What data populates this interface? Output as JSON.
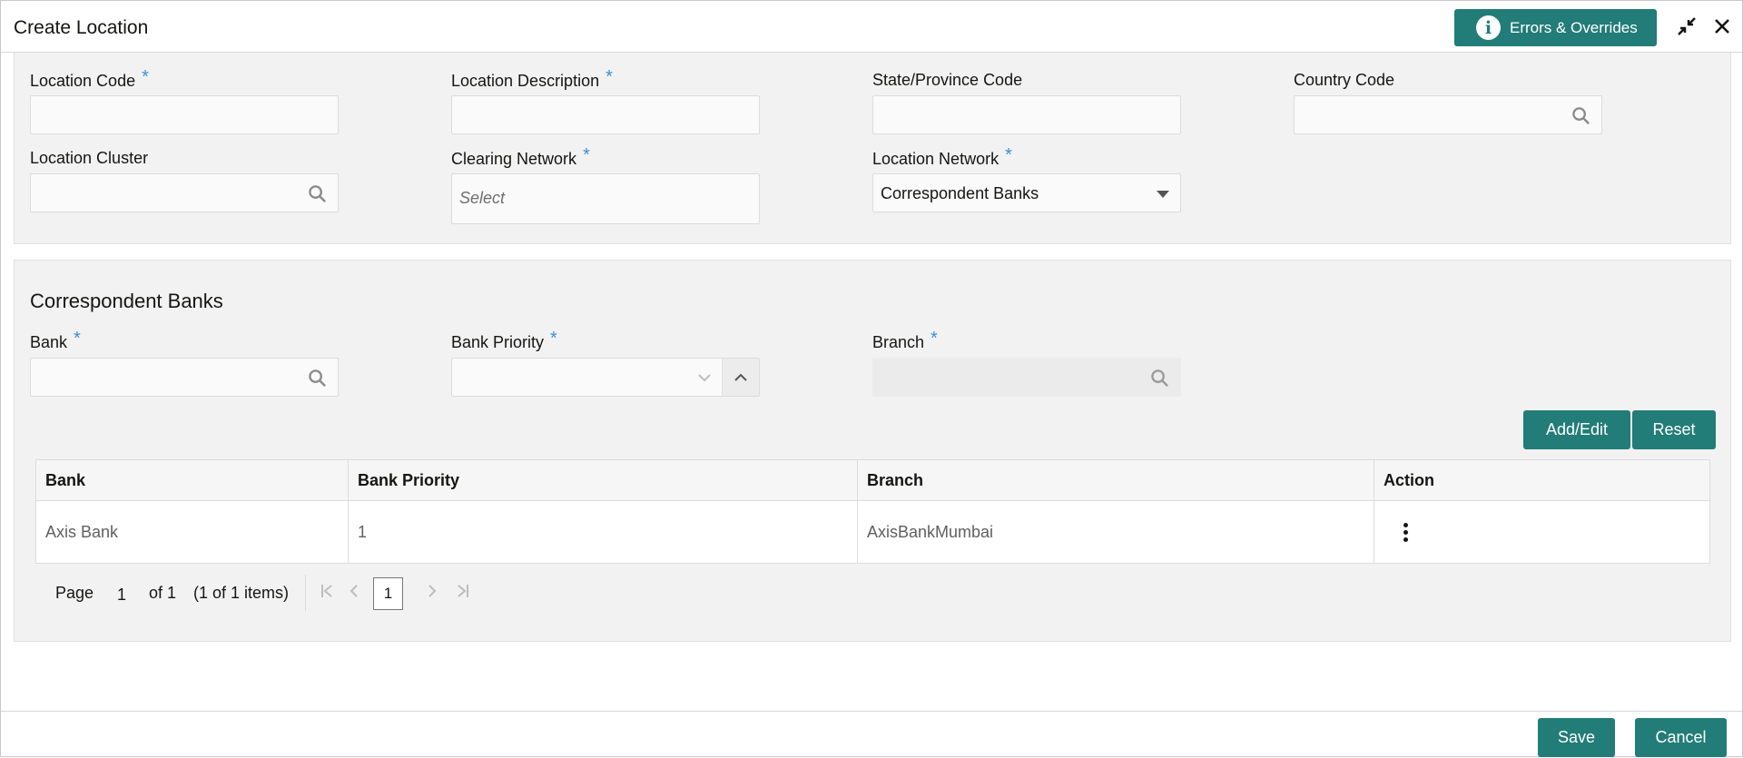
{
  "header": {
    "title": "Create Location",
    "errors_button": "Errors & Overrides",
    "info_icon": "i"
  },
  "form": {
    "location_code": {
      "label": "Location Code",
      "required": "*",
      "value": ""
    },
    "location_description": {
      "label": "Location Description",
      "required": "*",
      "value": ""
    },
    "state_province_code": {
      "label": "State/Province Code",
      "value": ""
    },
    "country_code": {
      "label": "Country Code",
      "value": ""
    },
    "location_cluster": {
      "label": "Location Cluster",
      "value": ""
    },
    "clearing_network": {
      "label": "Clearing Network",
      "required": "*",
      "placeholder": "Select"
    },
    "location_network": {
      "label": "Location Network",
      "required": "*",
      "value": "Correspondent Banks"
    }
  },
  "correspondent": {
    "title": "Correspondent Banks",
    "bank": {
      "label": "Bank",
      "required": "*",
      "value": ""
    },
    "bank_priority": {
      "label": "Bank Priority",
      "required": "*",
      "value": ""
    },
    "branch": {
      "label": "Branch",
      "required": "*",
      "value": ""
    },
    "add_edit": "Add/Edit",
    "reset": "Reset"
  },
  "table": {
    "columns": [
      "Bank",
      "Bank Priority",
      "Branch",
      "Action"
    ],
    "rows": [
      {
        "bank": "Axis Bank",
        "priority": "1",
        "branch": "AxisBankMumbai"
      }
    ]
  },
  "pager": {
    "page_label": "Page",
    "page": "1",
    "of": "of 1",
    "items": "(1 of 1 items)",
    "current": "1"
  },
  "footer": {
    "save": "Save",
    "cancel": "Cancel"
  },
  "colors": {
    "accent": "#227c77",
    "required": "#3b90d6"
  },
  "icons": [
    "info-icon",
    "minimize-icon",
    "close-icon",
    "search-icon",
    "caret-down-icon",
    "chevron-down-icon",
    "chevron-up-icon",
    "kebab-icon",
    "first-page-icon",
    "prev-page-icon",
    "next-page-icon",
    "last-page-icon"
  ]
}
